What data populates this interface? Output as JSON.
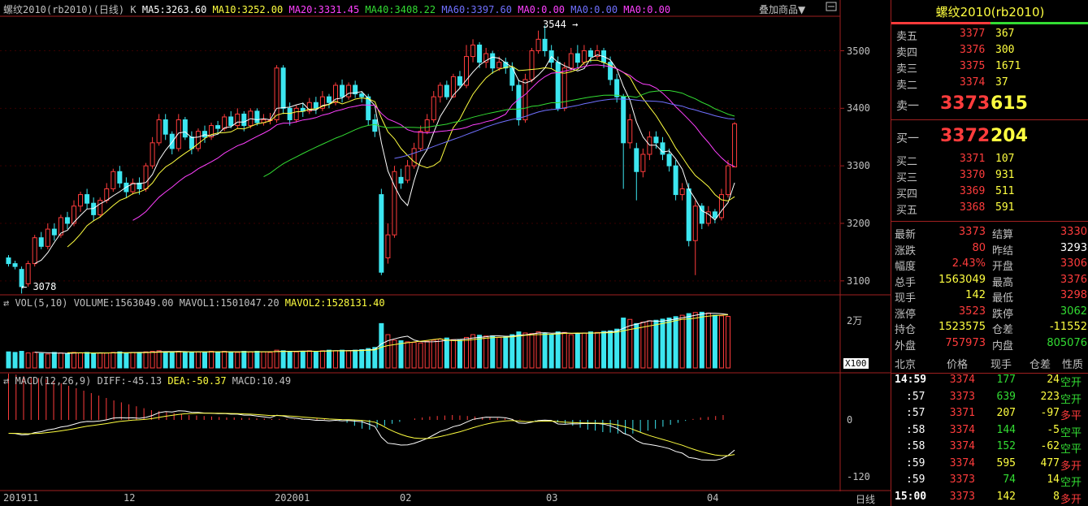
{
  "header": {
    "title_left": "螺纹2010(rb2010)(日线) K",
    "ma": [
      {
        "label": "MA5:3263.60",
        "color": "#ffffff"
      },
      {
        "label": "MA10:3252.00",
        "color": "#ffff40"
      },
      {
        "label": "MA20:3331.45",
        "color": "#ff40ff"
      },
      {
        "label": "MA40:3408.22",
        "color": "#33dd33"
      },
      {
        "label": "MA60:3397.60",
        "color": "#7070ff"
      },
      {
        "label": "MA0:0.00",
        "color": "#ff40ff"
      },
      {
        "label": "MA0:0.00",
        "color": "#7070ff"
      },
      {
        "label": "MA0:0.00",
        "color": "#ff40ff"
      }
    ],
    "overlay_button": "叠加商品▼"
  },
  "price_axis": [
    "3500",
    "3400",
    "3300",
    "3200",
    "3100"
  ],
  "price_marks": {
    "high": "3544",
    "low": "3078"
  },
  "volume": {
    "header_prefix": "VOL(5,10) VOLUME:1563049.00 MAVOL1:1501047.20",
    "mavol2": "MAVOL2:1528131.40",
    "axis_top": "2万",
    "unit": "X100"
  },
  "macd": {
    "header_prefix": "MACD(12,26,9) DIFF:-45.13",
    "dea": "DEA:-50.37",
    "macd_val": "MACD:10.49",
    "axis": [
      "0",
      "-120"
    ]
  },
  "date_axis": [
    "201911",
    "12",
    "202001",
    "02",
    "03",
    "04"
  ],
  "period_button": "日线",
  "chart_data": {
    "type": "candlestick",
    "symbol": "螺纹2010(rb2010)",
    "period": "日线",
    "ylim": [
      3080,
      3560
    ],
    "candles": [
      [
        3140,
        3130,
        3145,
        3125
      ],
      [
        3130,
        3125,
        3135,
        3120
      ],
      [
        3120,
        3090,
        3125,
        3078
      ],
      [
        3095,
        3130,
        3135,
        3090
      ],
      [
        3130,
        3175,
        3180,
        3125
      ],
      [
        3175,
        3160,
        3185,
        3155
      ],
      [
        3160,
        3190,
        3200,
        3155
      ],
      [
        3190,
        3180,
        3200,
        3170
      ],
      [
        3180,
        3210,
        3215,
        3175
      ],
      [
        3210,
        3200,
        3220,
        3190
      ],
      [
        3200,
        3230,
        3240,
        3195
      ],
      [
        3230,
        3250,
        3255,
        3220
      ],
      [
        3250,
        3235,
        3260,
        3225
      ],
      [
        3235,
        3215,
        3245,
        3205
      ],
      [
        3215,
        3240,
        3245,
        3210
      ],
      [
        3240,
        3260,
        3270,
        3235
      ],
      [
        3260,
        3290,
        3295,
        3255
      ],
      [
        3290,
        3270,
        3300,
        3262
      ],
      [
        3270,
        3255,
        3280,
        3245
      ],
      [
        3255,
        3270,
        3278,
        3250
      ],
      [
        3270,
        3260,
        3280,
        3250
      ],
      [
        3260,
        3300,
        3305,
        3255
      ],
      [
        3300,
        3340,
        3350,
        3295
      ],
      [
        3340,
        3380,
        3390,
        3335
      ],
      [
        3380,
        3355,
        3390,
        3345
      ],
      [
        3355,
        3330,
        3360,
        3320
      ],
      [
        3330,
        3380,
        3390,
        3325
      ],
      [
        3380,
        3350,
        3385,
        3345
      ],
      [
        3350,
        3330,
        3360,
        3320
      ],
      [
        3330,
        3360,
        3365,
        3325
      ],
      [
        3360,
        3350,
        3370,
        3340
      ],
      [
        3350,
        3370,
        3375,
        3345
      ],
      [
        3370,
        3365,
        3378,
        3355
      ],
      [
        3365,
        3385,
        3390,
        3360
      ],
      [
        3385,
        3370,
        3395,
        3365
      ],
      [
        3370,
        3390,
        3400,
        3365
      ],
      [
        3390,
        3370,
        3395,
        3360
      ],
      [
        3370,
        3395,
        3400,
        3365
      ],
      [
        3395,
        3375,
        3400,
        3370
      ],
      [
        3375,
        3380,
        3390,
        3370
      ],
      [
        3380,
        3380,
        3392,
        3372
      ],
      [
        3380,
        3470,
        3475,
        3375
      ],
      [
        3470,
        3400,
        3475,
        3390
      ],
      [
        3400,
        3380,
        3410,
        3370
      ],
      [
        3380,
        3400,
        3405,
        3375
      ],
      [
        3400,
        3395,
        3410,
        3385
      ],
      [
        3395,
        3410,
        3418,
        3390
      ],
      [
        3410,
        3400,
        3420,
        3390
      ],
      [
        3400,
        3420,
        3430,
        3395
      ],
      [
        3420,
        3410,
        3425,
        3400
      ],
      [
        3410,
        3440,
        3445,
        3405
      ],
      [
        3440,
        3420,
        3450,
        3410
      ],
      [
        3420,
        3440,
        3445,
        3415
      ],
      [
        3440,
        3425,
        3448,
        3418
      ],
      [
        3425,
        3420,
        3430,
        3410
      ],
      [
        3420,
        3380,
        3425,
        3370
      ],
      [
        3380,
        3360,
        3390,
        3350
      ],
      [
        3250,
        3115,
        3260,
        3110
      ],
      [
        3140,
        3180,
        3200,
        3130
      ],
      [
        3180,
        3290,
        3300,
        3175
      ],
      [
        3280,
        3270,
        3295,
        3260
      ],
      [
        3275,
        3300,
        3310,
        3270
      ],
      [
        3300,
        3330,
        3340,
        3295
      ],
      [
        3330,
        3360,
        3370,
        3325
      ],
      [
        3360,
        3380,
        3390,
        3355
      ],
      [
        3380,
        3420,
        3430,
        3375
      ],
      [
        3420,
        3440,
        3445,
        3410
      ],
      [
        3440,
        3420,
        3448,
        3415
      ],
      [
        3420,
        3455,
        3460,
        3418
      ],
      [
        3455,
        3440,
        3465,
        3435
      ],
      [
        3440,
        3490,
        3510,
        3435
      ],
      [
        3490,
        3510,
        3520,
        3480
      ],
      [
        3510,
        3480,
        3515,
        3470
      ],
      [
        3480,
        3495,
        3505,
        3470
      ],
      [
        3495,
        3470,
        3500,
        3460
      ],
      [
        3470,
        3480,
        3490,
        3465
      ],
      [
        3480,
        3470,
        3488,
        3460
      ],
      [
        3470,
        3440,
        3480,
        3430
      ],
      [
        3440,
        3380,
        3450,
        3370
      ],
      [
        3380,
        3450,
        3460,
        3375
      ],
      [
        3450,
        3500,
        3505,
        3445
      ],
      [
        3500,
        3520,
        3535,
        3495
      ],
      [
        3520,
        3500,
        3544,
        3490
      ],
      [
        3500,
        3480,
        3510,
        3470
      ],
      [
        3480,
        3400,
        3490,
        3395
      ],
      [
        3400,
        3470,
        3480,
        3395
      ],
      [
        3470,
        3495,
        3505,
        3465
      ],
      [
        3495,
        3480,
        3510,
        3470
      ],
      [
        3480,
        3500,
        3510,
        3475
      ],
      [
        3500,
        3490,
        3505,
        3480
      ],
      [
        3490,
        3500,
        3510,
        3485
      ],
      [
        3500,
        3480,
        3505,
        3470
      ],
      [
        3480,
        3450,
        3490,
        3440
      ],
      [
        3450,
        3420,
        3460,
        3410
      ],
      [
        3420,
        3340,
        3425,
        3260
      ],
      [
        3340,
        3380,
        3390,
        3330
      ],
      [
        3330,
        3290,
        3340,
        3240
      ],
      [
        3290,
        3320,
        3330,
        3280
      ],
      [
        3320,
        3350,
        3360,
        3310
      ],
      [
        3350,
        3340,
        3360,
        3330
      ],
      [
        3340,
        3320,
        3350,
        3310
      ],
      [
        3320,
        3300,
        3330,
        3290
      ],
      [
        3300,
        3250,
        3310,
        3240
      ],
      [
        3250,
        3260,
        3270,
        3240
      ],
      [
        3260,
        3170,
        3270,
        3160
      ],
      [
        3170,
        3230,
        3240,
        3110
      ],
      [
        3230,
        3200,
        3235,
        3190
      ],
      [
        3200,
        3220,
        3230,
        3195
      ],
      [
        3220,
        3210,
        3225,
        3200
      ],
      [
        3210,
        3250,
        3260,
        3205
      ],
      [
        3250,
        3300,
        3310,
        3245
      ],
      [
        3298,
        3373,
        3376,
        3298
      ]
    ],
    "volume_x100": [
      580,
      560,
      600,
      540,
      560,
      520,
      500,
      560,
      540,
      520,
      560,
      540,
      560,
      520,
      540,
      540,
      560,
      580,
      540,
      560,
      560,
      580,
      600,
      620,
      580,
      560,
      600,
      580,
      560,
      580,
      560,
      600,
      580,
      600,
      580,
      560,
      600,
      580,
      600,
      580,
      560,
      640,
      620,
      600,
      580,
      600,
      620,
      600,
      620,
      640,
      620,
      640,
      620,
      640,
      660,
      700,
      740,
      1600,
      1200,
      1000,
      980,
      940,
      920,
      900,
      960,
      1000,
      1040,
      1080,
      1020,
      1000,
      1100,
      1200,
      1180,
      1150,
      1160,
      1100,
      1120,
      1200,
      1300,
      1260,
      1240,
      1300,
      1260,
      1200,
      1300,
      1280,
      1200,
      1240,
      1260,
      1300,
      1280,
      1320,
      1340,
      1400,
      1800,
      1750,
      1600,
      1650,
      1700,
      1720,
      1760,
      1800,
      1850,
      1900,
      1960,
      2000,
      2010,
      1980,
      1900,
      1880,
      1860
    ],
    "macd_hist": [
      95,
      93,
      90,
      88,
      86,
      84,
      80,
      75,
      70,
      65,
      60,
      55,
      50,
      45,
      40,
      36,
      32,
      28,
      24,
      20,
      18,
      16,
      14,
      12,
      10,
      9,
      8,
      7,
      6,
      5,
      5,
      4,
      4,
      3,
      3,
      2,
      2,
      2,
      1,
      1,
      2,
      4,
      2,
      0,
      -2,
      -6,
      -12,
      -18,
      -20,
      -16,
      -12,
      -8,
      -4,
      0,
      3,
      5,
      7,
      8,
      9,
      10,
      9,
      8,
      7,
      6,
      5,
      4,
      3,
      2,
      1,
      0,
      -1,
      -2,
      -3,
      -5,
      -8,
      -12,
      -16,
      -20,
      -22,
      -25,
      -26,
      -28,
      -30,
      -28,
      -25,
      -22,
      -18,
      -14,
      -10,
      -6,
      -2,
      2,
      5,
      6,
      8,
      10
    ],
    "series_names": [
      "MA5",
      "MA10",
      "MA20",
      "MA40",
      "MA60",
      "DIFF",
      "DEA"
    ]
  },
  "quote": {
    "title": "螺纹2010(rb2010)",
    "sell": [
      {
        "label": "卖五",
        "price": "3377",
        "vol": "367"
      },
      {
        "label": "卖四",
        "price": "3376",
        "vol": "300"
      },
      {
        "label": "卖三",
        "price": "3375",
        "vol": "1671"
      },
      {
        "label": "卖二",
        "price": "3374",
        "vol": "37"
      }
    ],
    "sell1": {
      "label": "卖一",
      "price": "3373",
      "vol": "615"
    },
    "buy1": {
      "label": "买一",
      "price": "3372",
      "vol": "204"
    },
    "buy": [
      {
        "label": "买二",
        "price": "3371",
        "vol": "107"
      },
      {
        "label": "买三",
        "price": "3370",
        "vol": "931"
      },
      {
        "label": "买四",
        "price": "3369",
        "vol": "511"
      },
      {
        "label": "买五",
        "price": "3368",
        "vol": "591"
      }
    ],
    "stats": [
      {
        "l1": "最新",
        "v1": "3373",
        "c1": "red",
        "l2": "结算",
        "v2": "3330",
        "c2": "red"
      },
      {
        "l1": "涨跌",
        "v1": "80",
        "c1": "red",
        "l2": "昨结",
        "v2": "3293",
        "c2": "white"
      },
      {
        "l1": "幅度",
        "v1": "2.43%",
        "c1": "red",
        "l2": "开盘",
        "v2": "3306",
        "c2": "red"
      },
      {
        "l1": "总手",
        "v1": "1563049",
        "c1": "yellow",
        "l2": "最高",
        "v2": "3376",
        "c2": "red"
      },
      {
        "l1": "现手",
        "v1": "142",
        "c1": "yellow",
        "l2": "最低",
        "v2": "3298",
        "c2": "red"
      },
      {
        "l1": "涨停",
        "v1": "3523",
        "c1": "red",
        "l2": "跌停",
        "v2": "3062",
        "c2": "green"
      },
      {
        "l1": "持仓",
        "v1": "1523575",
        "c1": "yellow",
        "l2": "仓差",
        "v2": "-11552",
        "c2": "yellow"
      },
      {
        "l1": "外盘",
        "v1": "757973",
        "c1": "red",
        "l2": "内盘",
        "v2": "805076",
        "c2": "green"
      }
    ],
    "tick_header": [
      "北京",
      "价格",
      "现手",
      "仓差",
      "性质"
    ],
    "ticks": [
      {
        "time": "14:59",
        "price": "3374",
        "vol": "177",
        "diff": "24",
        "nat": "空开",
        "nc": "green",
        "bold": true
      },
      {
        "time": ":57",
        "price": "3373",
        "vol": "639",
        "diff": "223",
        "nat": "空开",
        "nc": "green"
      },
      {
        "time": ":57",
        "price": "3371",
        "vol": "207",
        "diff": "-97",
        "nat": "多平",
        "nc": "red"
      },
      {
        "time": ":58",
        "price": "3374",
        "vol": "144",
        "diff": "-5",
        "nat": "空平",
        "nc": "green"
      },
      {
        "time": ":58",
        "price": "3374",
        "vol": "152",
        "diff": "-62",
        "nat": "空平",
        "nc": "green"
      },
      {
        "time": ":59",
        "price": "3374",
        "vol": "595",
        "diff": "477",
        "nat": "多开",
        "nc": "red"
      },
      {
        "time": ":59",
        "price": "3373",
        "vol": "74",
        "diff": "14",
        "nat": "空开",
        "nc": "green"
      },
      {
        "time": "15:00",
        "price": "3373",
        "vol": "142",
        "diff": "8",
        "nat": "多开",
        "nc": "red",
        "bold": true
      }
    ]
  }
}
